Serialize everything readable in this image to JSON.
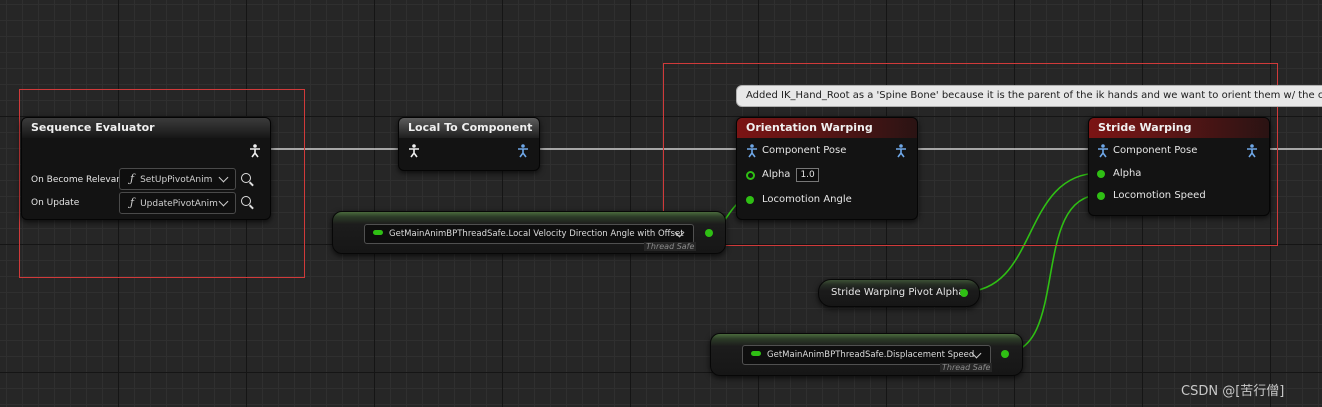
{
  "nodes": {
    "sequence_evaluator": {
      "title": "Sequence Evaluator",
      "rows": [
        {
          "label": "On Become Relevant",
          "function": "SetUpPivotAnim"
        },
        {
          "label": "On Update",
          "function": "UpdatePivotAnim"
        }
      ]
    },
    "local_to_component": {
      "title": "Local To Component"
    },
    "orientation_warping": {
      "title": "Orientation Warping",
      "pins": {
        "component_pose": "Component Pose",
        "alpha": "Alpha",
        "alpha_value": "1.0",
        "locomotion_angle": "Locomotion Angle"
      }
    },
    "stride_warping": {
      "title": "Stride Warping",
      "pins": {
        "component_pose": "Component Pose",
        "alpha": "Alpha",
        "locomotion_speed": "Locomotion Speed"
      }
    },
    "velocity_getter": {
      "value": "GetMainAnimBPThreadSafe.Local Velocity Direction Angle with Offset",
      "tag": "Thread Safe"
    },
    "pivot_alpha_var": {
      "label": "Stride Warping Pivot Alpha"
    },
    "displacement_getter": {
      "value": "GetMainAnimBPThreadSafe.Displacement Speed",
      "tag": "Thread Safe"
    }
  },
  "comment_bubble": "Added IK_Hand_Root as a 'Spine Bone' because it is the parent of the ik hands and we want to orient them w/ the ch",
  "watermark": "CSDN @[苦行僧]",
  "colors": {
    "float_pin": "#2fbf14",
    "pose_pin": "#6fa8e8",
    "selection": "#d03a3a",
    "node_red_header": "#7b1414"
  }
}
